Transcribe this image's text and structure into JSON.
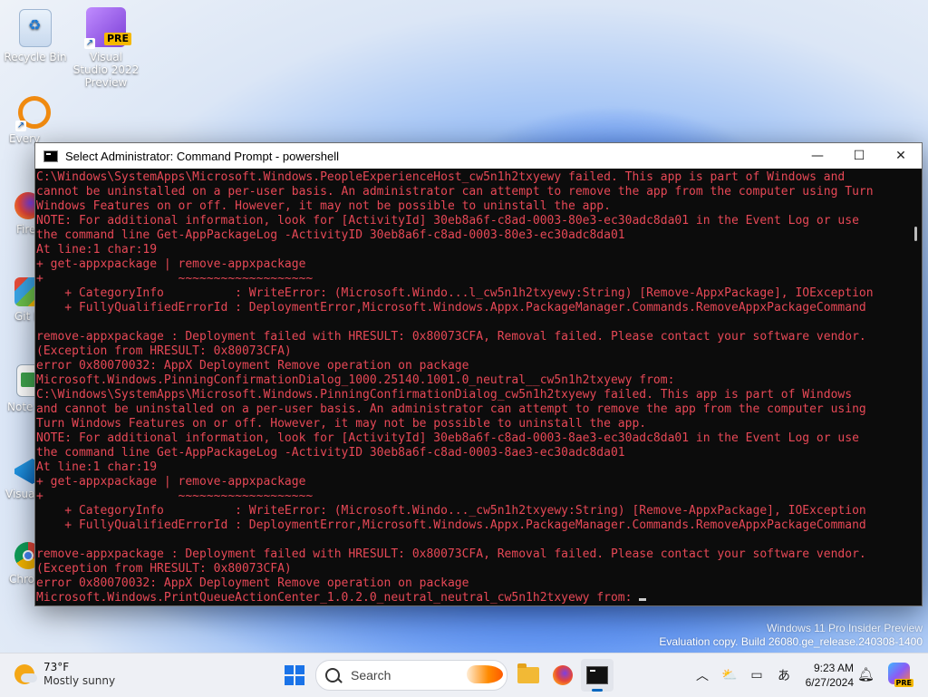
{
  "desktop": {
    "icons": [
      {
        "label": "Recycle Bin"
      },
      {
        "label": "Visual Studio 2022 Preview",
        "badge": "PRE"
      },
      {
        "label": "Every"
      },
      {
        "label": "Fire"
      },
      {
        "label": "Git B"
      },
      {
        "label": "Note"
      },
      {
        "label": "Visual Co"
      },
      {
        "label": "Chro"
      }
    ]
  },
  "window": {
    "title": "Select Administrator: Command Prompt - powershell",
    "controls": {
      "minimize": "—",
      "maximize": "☐",
      "close": "✕"
    },
    "lines": [
      "C:\\Windows\\SystemApps\\Microsoft.Windows.PeopleExperienceHost_cw5n1h2txyewy failed. This app is part of Windows and",
      "cannot be uninstalled on a per-user basis. An administrator can attempt to remove the app from the computer using Turn",
      "Windows Features on or off. However, it may not be possible to uninstall the app.",
      "NOTE: For additional information, look for [ActivityId] 30eb8a6f-c8ad-0003-80e3-ec30adc8da01 in the Event Log or use",
      "the command line Get-AppPackageLog -ActivityID 30eb8a6f-c8ad-0003-80e3-ec30adc8da01",
      "At line:1 char:19",
      "+ get-appxpackage | remove-appxpackage",
      "+                   ~~~~~~~~~~~~~~~~~~~",
      "    + CategoryInfo          : WriteError: (Microsoft.Windo...l_cw5n1h2txyewy:String) [Remove-AppxPackage], IOException",
      "    + FullyQualifiedErrorId : DeploymentError,Microsoft.Windows.Appx.PackageManager.Commands.RemoveAppxPackageCommand",
      "",
      "remove-appxpackage : Deployment failed with HRESULT: 0x80073CFA, Removal failed. Please contact your software vendor.",
      "(Exception from HRESULT: 0x80073CFA)",
      "error 0x80070032: AppX Deployment Remove operation on package",
      "Microsoft.Windows.PinningConfirmationDialog_1000.25140.1001.0_neutral__cw5n1h2txyewy from:",
      "C:\\Windows\\SystemApps\\Microsoft.Windows.PinningConfirmationDialog_cw5n1h2txyewy failed. This app is part of Windows",
      "and cannot be uninstalled on a per-user basis. An administrator can attempt to remove the app from the computer using",
      "Turn Windows Features on or off. However, it may not be possible to uninstall the app.",
      "NOTE: For additional information, look for [ActivityId] 30eb8a6f-c8ad-0003-8ae3-ec30adc8da01 in the Event Log or use",
      "the command line Get-AppPackageLog -ActivityID 30eb8a6f-c8ad-0003-8ae3-ec30adc8da01",
      "At line:1 char:19",
      "+ get-appxpackage | remove-appxpackage",
      "+                   ~~~~~~~~~~~~~~~~~~~",
      "    + CategoryInfo          : WriteError: (Microsoft.Windo..._cw5n1h2txyewy:String) [Remove-AppxPackage], IOException",
      "    + FullyQualifiedErrorId : DeploymentError,Microsoft.Windows.Appx.PackageManager.Commands.RemoveAppxPackageCommand",
      "",
      "remove-appxpackage : Deployment failed with HRESULT: 0x80073CFA, Removal failed. Please contact your software vendor.",
      "(Exception from HRESULT: 0x80073CFA)",
      "error 0x80070032: AppX Deployment Remove operation on package",
      "Microsoft.Windows.PrintQueueActionCenter_1.0.2.0_neutral_neutral_cw5n1h2txyewy from: "
    ],
    "text_color": "#e74856"
  },
  "watermark": {
    "line1": "Windows 11 Pro Insider Preview",
    "line2": "Evaluation copy. Build 26080.ge_release.240308-1400"
  },
  "taskbar": {
    "weather": {
      "temp": "73°F",
      "desc": "Mostly sunny"
    },
    "search_label": "Search",
    "clock": {
      "time": "9:23 AM",
      "date": "6/27/2024"
    },
    "copilot_badge": "PRE"
  }
}
